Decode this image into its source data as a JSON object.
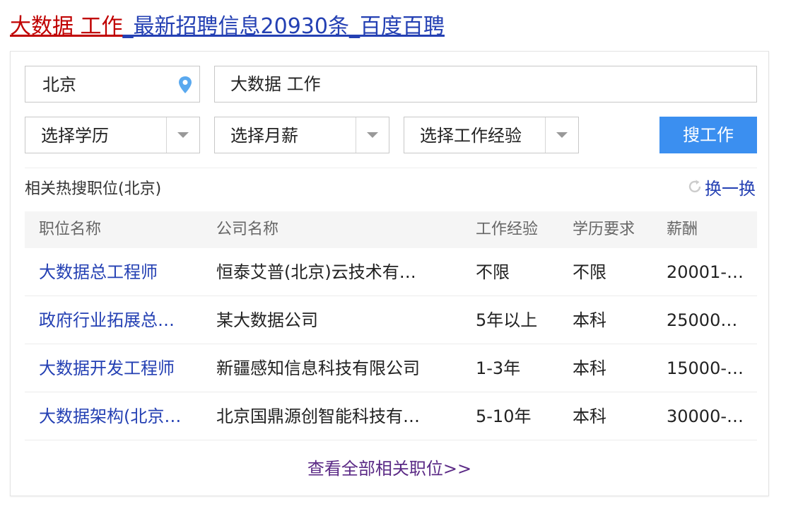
{
  "title": {
    "keyword_part": "大数据 工作",
    "rest_part": "_最新招聘信息20930条_百度百聘"
  },
  "search": {
    "city": "北京",
    "keyword": "大数据 工作",
    "education_select": "选择学历",
    "salary_select": "选择月薪",
    "experience_select": "选择工作经验",
    "button_label": "搜工作"
  },
  "hot": {
    "label": "相关热搜职位(北京)",
    "refresh_label": "换一换"
  },
  "table": {
    "headers": [
      "职位名称",
      "公司名称",
      "工作经验",
      "学历要求",
      "薪酬"
    ],
    "rows": [
      {
        "job": "大数据总工程师",
        "company": "恒泰艾普(北京)云技术有…",
        "experience": "不限",
        "education": "不限",
        "salary": "20001-…"
      },
      {
        "job": "政府行业拓展总…",
        "company": "某大数据公司",
        "experience": "5年以上",
        "education": "本科",
        "salary": "25000…"
      },
      {
        "job": "大数据开发工程师",
        "company": "新疆感知信息科技有限公司",
        "experience": "1-3年",
        "education": "本科",
        "salary": "15000-…"
      },
      {
        "job": "大数据架构(北京…",
        "company": "北京国鼎源创智能科技有…",
        "experience": "5-10年",
        "education": "本科",
        "salary": "30000-…"
      }
    ]
  },
  "footer": {
    "view_all": "查看全部相关职位>>"
  },
  "colors": {
    "link_blue": "#2440b3",
    "title_red": "#c00000",
    "button_blue": "#3b8ff0",
    "visited_purple": "#5b2a86"
  },
  "icons": {
    "location": "location-pin-icon",
    "refresh": "refresh-icon",
    "dropdown": "chevron-down-icon"
  }
}
